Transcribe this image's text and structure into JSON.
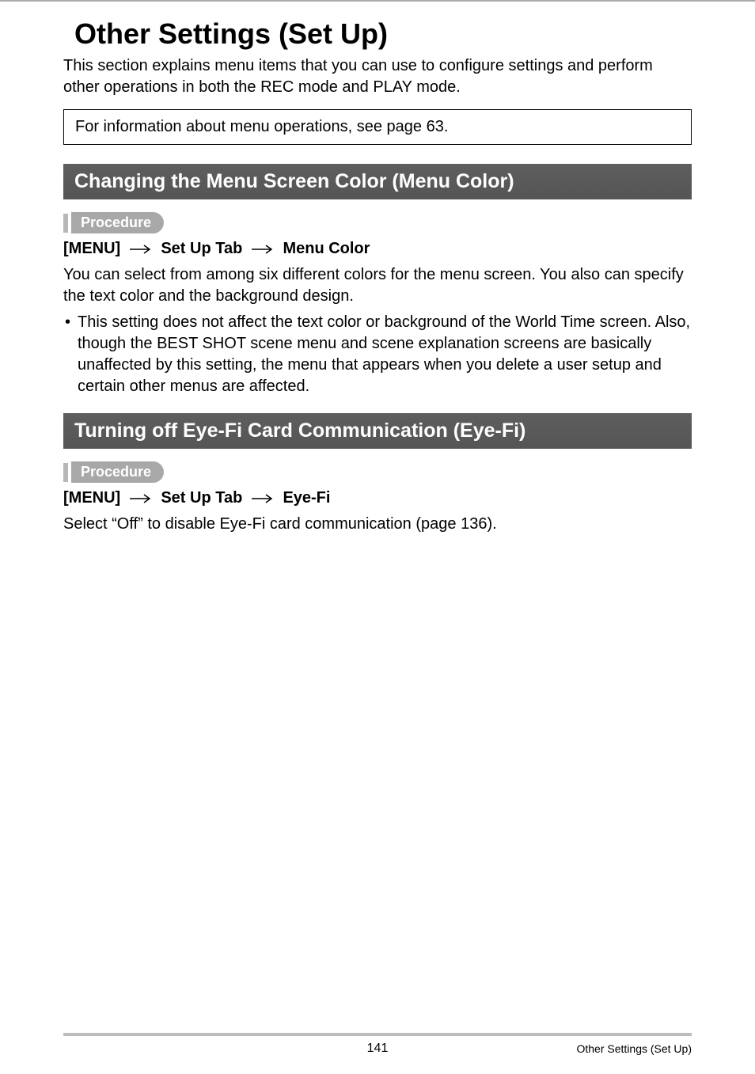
{
  "page": {
    "title": "Other Settings (Set Up)",
    "intro": "This section explains menu items that you can use to configure settings and perform other operations in both the REC mode and PLAY mode.",
    "info_box": "For information about menu operations, see page 63."
  },
  "sections": [
    {
      "heading": "Changing the Menu Screen Color (Menu Color)",
      "procedure_label": "Procedure",
      "breadcrumb": {
        "parts": [
          "[MENU]",
          "Set Up Tab",
          "Menu Color"
        ]
      },
      "body": "You can select from among six different colors for the menu screen. You also can specify the text color and the background design.",
      "bullet": "This setting does not affect the text color or background of the World Time screen. Also, though the BEST SHOT scene menu and scene explanation screens are basically unaffected by this setting, the menu that appears when you delete a user setup and certain other menus are affected."
    },
    {
      "heading": "Turning off Eye-Fi Card Communication (Eye-Fi)",
      "procedure_label": "Procedure",
      "breadcrumb": {
        "parts": [
          "[MENU]",
          "Set Up Tab",
          "Eye-Fi"
        ]
      },
      "body": "Select “Off” to disable Eye-Fi card communication (page 136)."
    }
  ],
  "footer": {
    "page_number": "141",
    "section_title": "Other Settings (Set Up)"
  }
}
